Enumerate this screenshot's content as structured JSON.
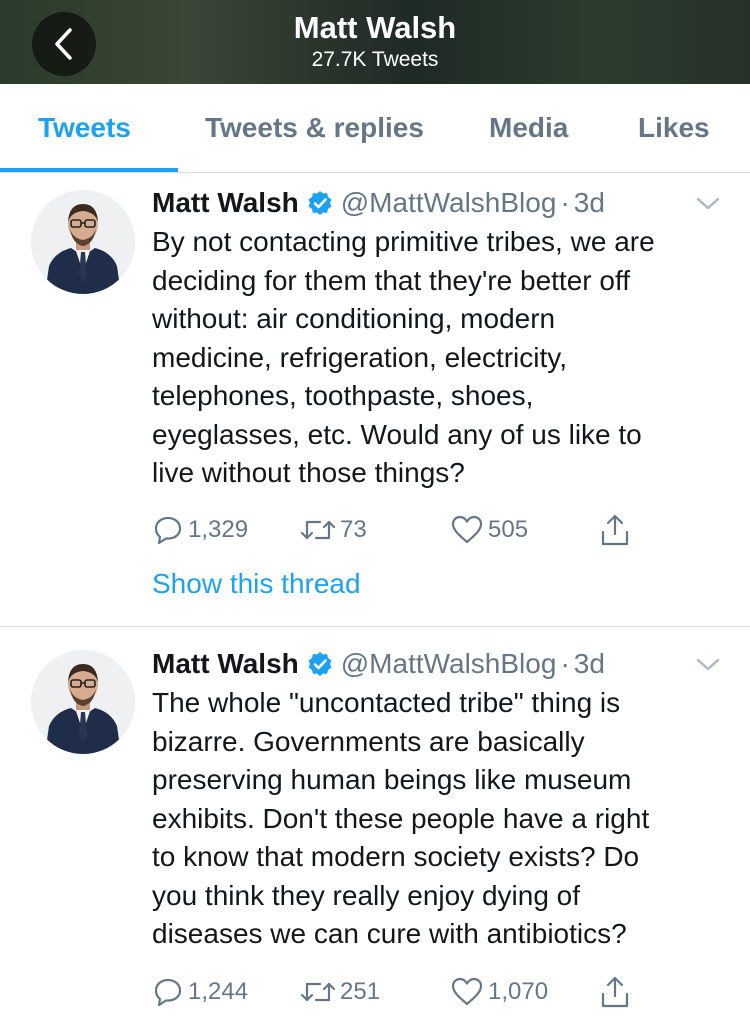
{
  "header": {
    "title": "Matt Walsh",
    "subtitle": "27.7K Tweets"
  },
  "tabs": [
    {
      "label": "Tweets",
      "active": true
    },
    {
      "label": "Tweets & replies",
      "active": false
    },
    {
      "label": "Media",
      "active": false
    },
    {
      "label": "Likes",
      "active": false
    }
  ],
  "colors": {
    "accent": "#1da1f2",
    "secondary_text": "#657786"
  },
  "tweets": [
    {
      "name": "Matt Walsh",
      "handle": "@MattWalshBlog",
      "dot": "·",
      "time": "3d",
      "text": "By not contacting primitive tribes, we are\ndeciding for them that they're better off\nwithout: air conditioning, modern\nmedicine, refrigeration, electricity,\ntelephones, toothpaste, shoes,\neyeglasses, etc. Would any of us like to\nlive without those things?",
      "replies": "1,329",
      "retweets": "73",
      "likes": "505",
      "show_thread": "Show this thread"
    },
    {
      "name": "Matt Walsh",
      "handle": "@MattWalshBlog",
      "dot": "·",
      "time": "3d",
      "text": "The whole \"uncontacted tribe\" thing is\nbizarre. Governments are basically\npreserving human beings like museum\nexhibits. Don't these people have a right\nto know that modern society exists? Do\nyou think they really enjoy dying of\ndiseases we can cure with antibiotics?",
      "replies": "1,244",
      "retweets": "251",
      "likes": "1,070"
    }
  ],
  "icons": {
    "back": "chevron-left-icon",
    "verified": "verified-badge-icon",
    "caret": "chevron-down-icon",
    "reply": "reply-bubble-icon",
    "retweet": "retweet-icon",
    "like": "heart-icon",
    "share": "share-icon"
  }
}
